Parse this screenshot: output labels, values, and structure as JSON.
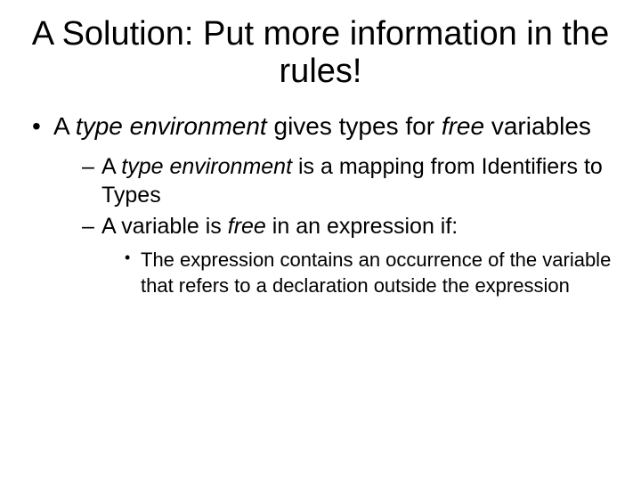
{
  "title": "A Solution: Put more information in the rules!",
  "b1_pre": "A ",
  "b1_em1": "type environment",
  "b1_mid": " gives types for ",
  "b1_em2": "free",
  "b1_post": " variables",
  "s1_pre": "A ",
  "s1_em": "type environment",
  "s1_post": " is a mapping from Identifiers to Types",
  "s2_pre": "A variable is ",
  "s2_em": "free",
  "s2_post": " in an expression if:",
  "t1": "The expression contains an occurrence of the variable that refers to a declaration outside the expression"
}
